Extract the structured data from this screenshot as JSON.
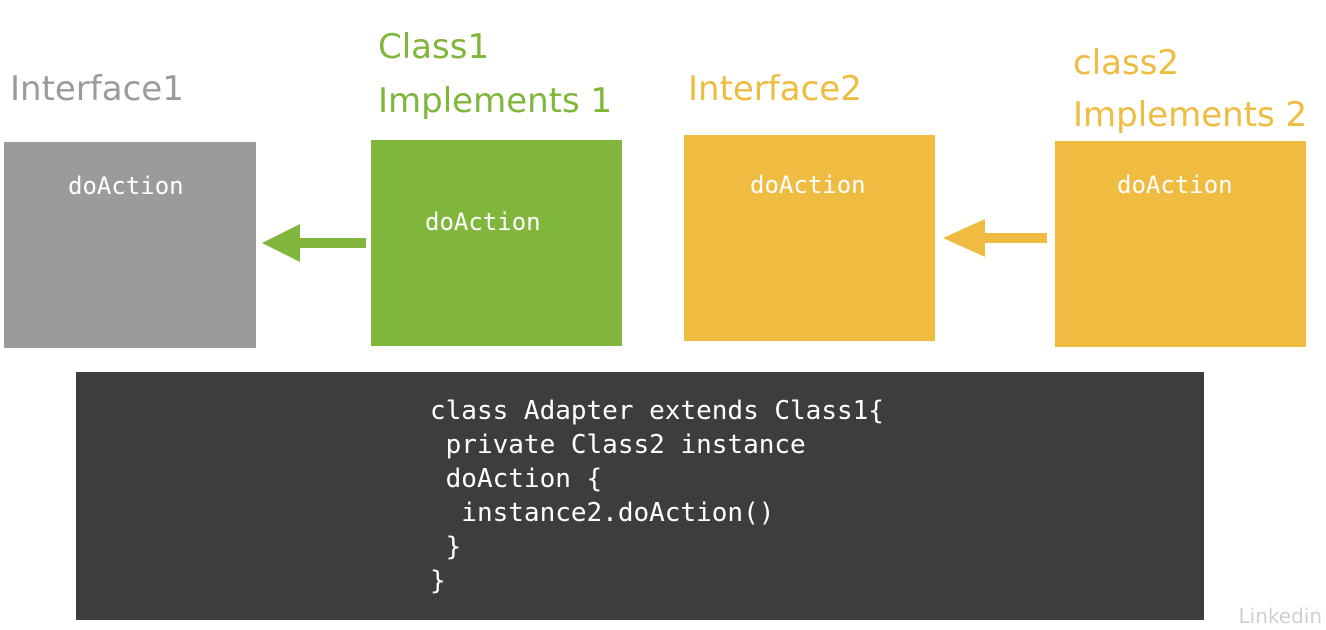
{
  "interface1": {
    "title": "Interface1",
    "method": "doAction"
  },
  "class1": {
    "title_line1": "Class1",
    "title_line2": "Implements 1",
    "method": "doAction"
  },
  "interface2": {
    "title": "Interface2",
    "method": "doAction"
  },
  "class2": {
    "title_line1": "class2",
    "title_line2": "Implements 2",
    "method": "doAction"
  },
  "code": {
    "lines": [
      "class Adapter extends Class1{",
      " private Class2 instance",
      " doAction {",
      "  instance2.doAction()",
      " }",
      "}"
    ]
  },
  "watermark": "Linkedin",
  "colors": {
    "gray": "#9b9b9d",
    "green": "#80b63b",
    "yellow": "#efbc41",
    "code_bg": "#3c3d3e"
  }
}
